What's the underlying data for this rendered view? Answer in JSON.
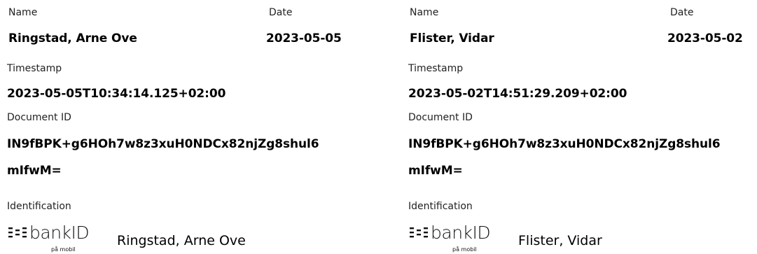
{
  "signers": [
    {
      "name_label": "Name",
      "name": "Ringstad, Arne Ove",
      "date_label": "Date",
      "date": "2023-05-05",
      "timestamp_label": "Timestamp",
      "timestamp": "2023-05-05T10:34:14.125+02:00",
      "document_id_label": "Document ID",
      "document_id_line1": "IN9fBPK+g6HOh7w8z3xuH0NDCx82njZg8shul6",
      "document_id_line2": "mIfwM=",
      "identification_label": "Identification",
      "identification_logo_text": "bankID",
      "identification_logo_sub": "på mobil",
      "identification_name": "Ringstad, Arne Ove"
    },
    {
      "name_label": "Name",
      "name": "Flister, Vidar",
      "date_label": "Date",
      "date": "2023-05-02",
      "timestamp_label": "Timestamp",
      "timestamp": "2023-05-02T14:51:29.209+02:00",
      "document_id_label": "Document ID",
      "document_id_line1": "IN9fBPK+g6HOh7w8z3xuH0NDCx82njZg8shul6",
      "document_id_line2": "mIfwM=",
      "identification_label": "Identification",
      "identification_logo_text": "bankID",
      "identification_logo_sub": "på mobil",
      "identification_name": "Flister, Vidar"
    }
  ]
}
